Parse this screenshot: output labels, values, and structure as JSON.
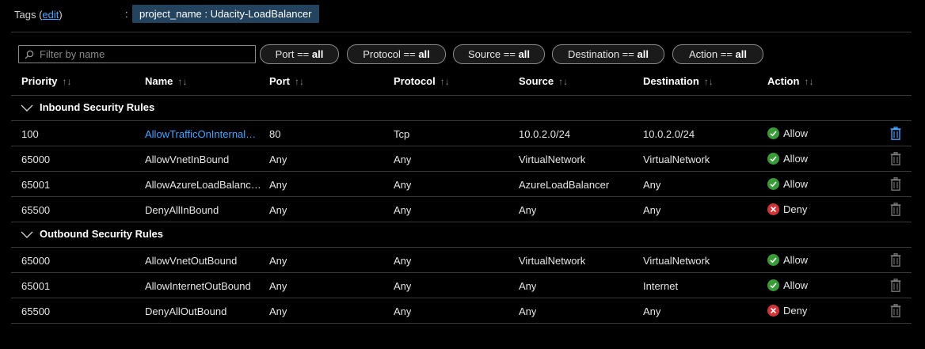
{
  "tags": {
    "label": "Tags (",
    "edit": "edit",
    "close": ")",
    "colon": ":",
    "chip": "project_name : Udacity-LoadBalancer"
  },
  "filter": {
    "placeholder": "Filter by name"
  },
  "pills": [
    {
      "label": "Port == ",
      "value": "all"
    },
    {
      "label": "Protocol == ",
      "value": "all"
    },
    {
      "label": "Source == ",
      "value": "all"
    },
    {
      "label": "Destination == ",
      "value": "all"
    },
    {
      "label": "Action == ",
      "value": "all"
    }
  ],
  "columns": [
    "Priority",
    "Name",
    "Port",
    "Protocol",
    "Source",
    "Destination",
    "Action"
  ],
  "sort_glyph": "↑↓",
  "groups": [
    {
      "title": "Inbound Security Rules",
      "rules": [
        {
          "priority": "100",
          "name": "AllowTrafficOnInternalS…",
          "port": "80",
          "protocol": "Tcp",
          "source": "10.0.2.0/24",
          "destination": "10.0.2.0/24",
          "action": "Allow"
        },
        {
          "priority": "65000",
          "name": "AllowVnetInBound",
          "port": "Any",
          "protocol": "Any",
          "source": "VirtualNetwork",
          "destination": "VirtualNetwork",
          "action": "Allow"
        },
        {
          "priority": "65001",
          "name": "AllowAzureLoadBalance…",
          "port": "Any",
          "protocol": "Any",
          "source": "AzureLoadBalancer",
          "destination": "Any",
          "action": "Allow"
        },
        {
          "priority": "65500",
          "name": "DenyAllInBound",
          "port": "Any",
          "protocol": "Any",
          "source": "Any",
          "destination": "Any",
          "action": "Deny"
        }
      ]
    },
    {
      "title": "Outbound Security Rules",
      "rules": [
        {
          "priority": "65000",
          "name": "AllowVnetOutBound",
          "port": "Any",
          "protocol": "Any",
          "source": "VirtualNetwork",
          "destination": "VirtualNetwork",
          "action": "Allow"
        },
        {
          "priority": "65001",
          "name": "AllowInternetOutBound",
          "port": "Any",
          "protocol": "Any",
          "source": "Any",
          "destination": "Internet",
          "action": "Allow"
        },
        {
          "priority": "65500",
          "name": "DenyAllOutBound",
          "port": "Any",
          "protocol": "Any",
          "source": "Any",
          "destination": "Any",
          "action": "Deny"
        }
      ]
    }
  ],
  "colors": {
    "allow": "#3a9a3a",
    "deny": "#d13438",
    "link": "#4aa3ff",
    "chip_bg": "#24435e",
    "delete_active": "#4aa3ff",
    "delete_idle": "#7a7a7a"
  },
  "icons": {
    "search": "search-icon",
    "chevron": "chevron-down-icon",
    "allow": "check-circle-icon",
    "deny": "x-circle-icon",
    "delete": "trash-icon"
  }
}
